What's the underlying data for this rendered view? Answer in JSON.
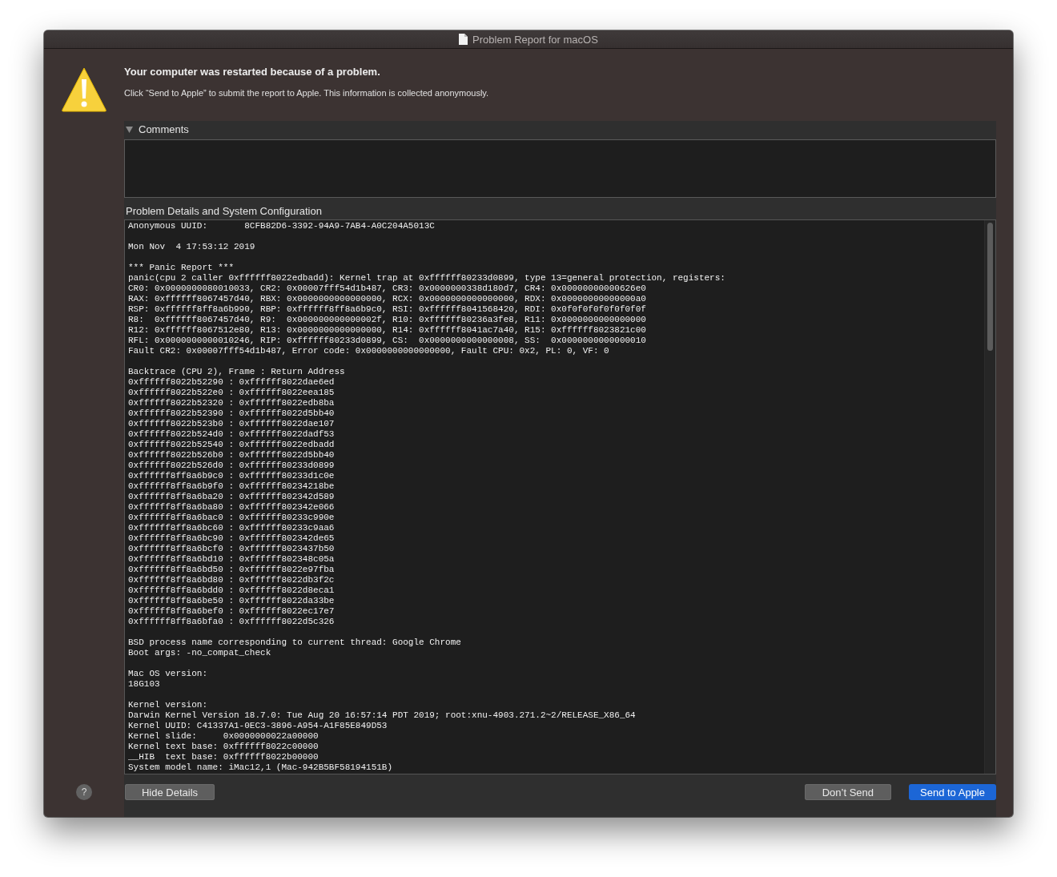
{
  "window": {
    "title": "Problem Report for macOS"
  },
  "message": {
    "heading": "Your computer was restarted because of a problem.",
    "body": "Click “Send to Apple” to submit the report to Apple. This information is collected anonymously."
  },
  "comments": {
    "label": "Comments",
    "expanded": true
  },
  "details": {
    "label": "Problem Details and System Configuration",
    "report": [
      [
        "Anonymous UUID:       8CFB82D6-3392-94A9-7AB4-A0C204A5013C"
      ],
      [
        "Mon Nov  4 17:53:12 2019"
      ],
      [
        "*** Panic Report ***",
        "panic(cpu 2 caller 0xffffff8022edbadd): Kernel trap at 0xffffff80233d0899, type 13=general protection, registers:",
        "CR0: 0x0000000080010033, CR2: 0x00007fff54d1b487, CR3: 0x0000000338d180d7, CR4: 0x00000000000626e0",
        "RAX: 0xffffff8067457d40, RBX: 0x0000000000000000, RCX: 0x0000000000000000, RDX: 0x00000000000000a0",
        "RSP: 0xffffff8ff8a6b990, RBP: 0xffffff8ff8a6b9c0, RSI: 0xffffff8041568420, RDI: 0x0f0f0f0f0f0f0f0f",
        "R8:  0xffffff8067457d40, R9:  0x000000000000002f, R10: 0xffffff80236a3fe8, R11: 0x0000000000000000",
        "R12: 0xffffff8067512e80, R13: 0x0000000000000000, R14: 0xffffff8041ac7a40, R15: 0xffffff8023821c00",
        "RFL: 0x0000000000010246, RIP: 0xffffff80233d0899, CS:  0x0000000000000008, SS:  0x0000000000000010",
        "Fault CR2: 0x00007fff54d1b487, Error code: 0x0000000000000000, Fault CPU: 0x2, PL: 0, VF: 0"
      ],
      [
        "Backtrace (CPU 2), Frame : Return Address",
        "0xffffff8022b52290 : 0xffffff8022dae6ed",
        "0xffffff8022b522e0 : 0xffffff8022eea185",
        "0xffffff8022b52320 : 0xffffff8022edb8ba",
        "0xffffff8022b52390 : 0xffffff8022d5bb40",
        "0xffffff8022b523b0 : 0xffffff8022dae107",
        "0xffffff8022b524d0 : 0xffffff8022dadf53",
        "0xffffff8022b52540 : 0xffffff8022edbadd",
        "0xffffff8022b526b0 : 0xffffff8022d5bb40",
        "0xffffff8022b526d0 : 0xffffff80233d0899",
        "0xffffff8ff8a6b9c0 : 0xffffff80233d1c0e",
        "0xffffff8ff8a6b9f0 : 0xffffff80234218be",
        "0xffffff8ff8a6ba20 : 0xffffff802342d589",
        "0xffffff8ff8a6ba80 : 0xffffff802342e066",
        "0xffffff8ff8a6bac0 : 0xffffff80233c990e",
        "0xffffff8ff8a6bc60 : 0xffffff80233c9aa6",
        "0xffffff8ff8a6bc90 : 0xffffff802342de65",
        "0xffffff8ff8a6bcf0 : 0xffffff8023437b50",
        "0xffffff8ff8a6bd10 : 0xffffff802348c05a",
        "0xffffff8ff8a6bd50 : 0xffffff8022e97fba",
        "0xffffff8ff8a6bd80 : 0xffffff8022db3f2c",
        "0xffffff8ff8a6bdd0 : 0xffffff8022d8eca1",
        "0xffffff8ff8a6be50 : 0xffffff8022da33be",
        "0xffffff8ff8a6bef0 : 0xffffff8022ec17e7",
        "0xffffff8ff8a6bfa0 : 0xffffff8022d5c326"
      ],
      [
        "BSD process name corresponding to current thread: Google Chrome",
        "Boot args: -no_compat_check"
      ],
      [
        "Mac OS version:",
        "18G103"
      ],
      [
        "Kernel version:",
        "Darwin Kernel Version 18.7.0: Tue Aug 20 16:57:14 PDT 2019; root:xnu-4903.271.2~2/RELEASE_X86_64",
        "Kernel UUID: C41337A1-0EC3-3896-A954-A1F85E849D53",
        "Kernel slide:     0x0000000022a00000",
        "Kernel text base: 0xffffff8022c00000",
        "__HIB  text base: 0xffffff8022b00000",
        "System model name: iMac12,1 (Mac-942B5BF58194151B)"
      ]
    ]
  },
  "buttons": [
    {
      "kind": "help",
      "label": "?"
    },
    {
      "kind": "details",
      "label": "Hide Details"
    },
    {
      "kind": "secondary",
      "label": "Don’t Send"
    },
    {
      "kind": "primary",
      "label": "Send to Apple"
    }
  ]
}
